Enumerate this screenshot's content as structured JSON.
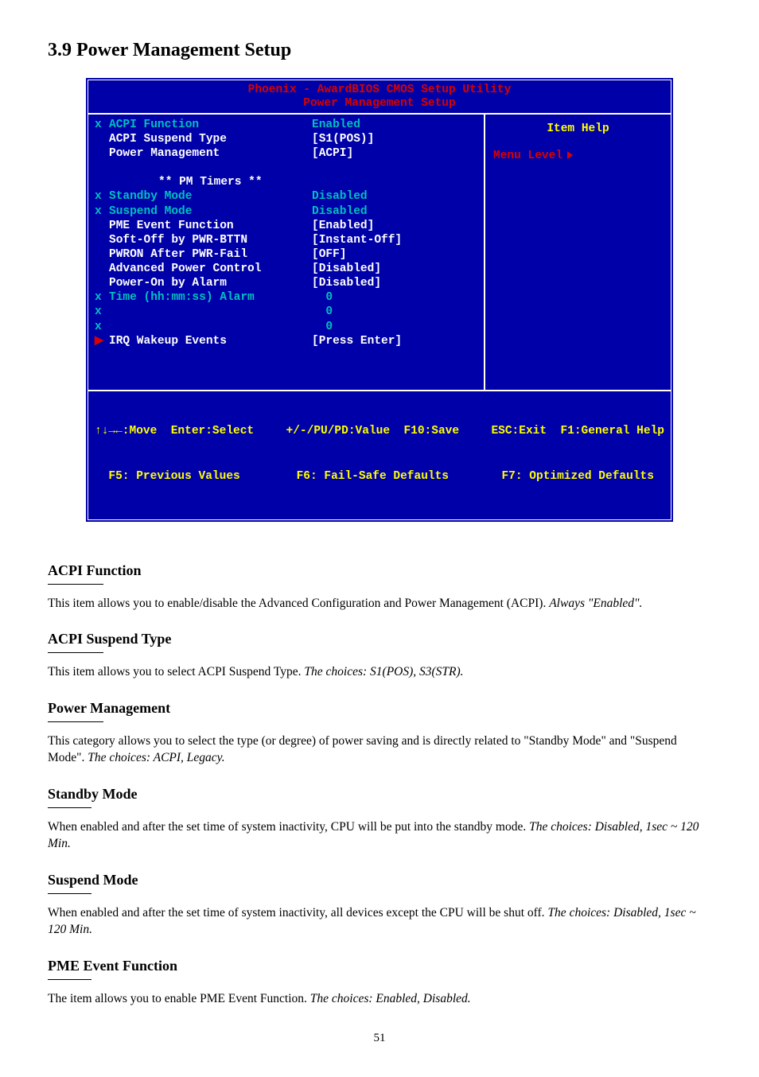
{
  "page_heading": "3.9 Power Management Setup",
  "bios": {
    "title_line1": "Phoenix - AwardBIOS CMOS Setup Utility",
    "title_line2": "Power Management Setup",
    "help_title": "Item Help",
    "menu_level": "Menu Level",
    "timers_header": "** PM Timers **",
    "rows": [
      {
        "marker": "x",
        "marker_color": "cyan",
        "label": "ACPI Function",
        "label_color": "cyan",
        "value": "Enabled",
        "value_color": "cyan"
      },
      {
        "marker": "",
        "marker_color": "",
        "label": "ACPI Suspend Type",
        "label_color": "white",
        "value": "[S1(POS)]",
        "value_color": "white"
      },
      {
        "marker": "",
        "marker_color": "",
        "label": "Power Management",
        "label_color": "white",
        "value": "[ACPI]",
        "value_color": "white"
      }
    ],
    "rows2": [
      {
        "marker": "x",
        "marker_color": "cyan",
        "label": "Standby Mode",
        "label_color": "cyan",
        "value": "Disabled",
        "value_color": "cyan"
      },
      {
        "marker": "x",
        "marker_color": "cyan",
        "label": "Suspend Mode",
        "label_color": "cyan",
        "value": "Disabled",
        "value_color": "cyan"
      },
      {
        "marker": "",
        "marker_color": "",
        "label": "PME Event Function",
        "label_color": "white",
        "value": "[Enabled]",
        "value_color": "white"
      },
      {
        "marker": "",
        "marker_color": "",
        "label": "Soft-Off by PWR-BTTN",
        "label_color": "white",
        "value": "[Instant-Off]",
        "value_color": "white"
      },
      {
        "marker": "",
        "marker_color": "",
        "label": "PWRON After PWR-Fail",
        "label_color": "white",
        "value": "[OFF]",
        "value_color": "white"
      },
      {
        "marker": "",
        "marker_color": "",
        "label": "Advanced Power Control",
        "label_color": "white",
        "value": "[Disabled]",
        "value_color": "white"
      },
      {
        "marker": "",
        "marker_color": "",
        "label": "Power-On by Alarm",
        "label_color": "white",
        "value": "[Disabled]",
        "value_color": "white"
      },
      {
        "marker": "x",
        "marker_color": "cyan",
        "label": "Time (hh:mm:ss) Alarm",
        "label_color": "cyan",
        "value": "  0",
        "value_color": "cyan"
      },
      {
        "marker": "x",
        "marker_color": "cyan",
        "label": "",
        "label_color": "cyan",
        "value": "  0",
        "value_color": "cyan"
      },
      {
        "marker": "x",
        "marker_color": "cyan",
        "label": "",
        "label_color": "cyan",
        "value": "  0",
        "value_color": "cyan"
      },
      {
        "marker": "▶",
        "marker_color": "red",
        "label": "IRQ Wakeup Events",
        "label_color": "white",
        "value": "[Press Enter]",
        "value_color": "white"
      }
    ],
    "footer": {
      "l1c1": "↑↓→←:Move  Enter:Select",
      "l1c2": "+/-/PU/PD:Value  F10:Save",
      "l1c3": "ESC:Exit  F1:General Help",
      "l2c1": "F5: Previous Values",
      "l2c2": "F6: Fail-Safe Defaults",
      "l2c3": "F7: Optimized Defaults"
    }
  },
  "sections": [
    {
      "title": "ACPI Function",
      "rule_w": "w70",
      "body_html": "This item allows you to enable/disable the Advanced Configuration and Power Management (ACPI). <span class=\"italic\">Always \"Enabled\".</span>"
    },
    {
      "title": "ACPI Suspend Type",
      "rule_w": "w70",
      "body_html": "This item allows you to select ACPI Suspend Type. <span class=\"italic\">The choices: S1(POS), S3(STR).</span>"
    },
    {
      "title": "Power Management",
      "rule_w": "w70",
      "body_html": "This category allows you to select the type (or degree) of power saving and is directly related to \"Standby Mode\" and \"Suspend Mode\". <span class=\"italic\">The choices: ACPI, Legacy.</span>"
    },
    {
      "title": "Standby Mode",
      "rule_w": "w60",
      "body_html": "When enabled and after the set time of system inactivity, CPU will be put into the standby mode. <span class=\"italic\">The choices: Disabled, 1sec ~ 120 Min.</span>"
    },
    {
      "title": "Suspend Mode",
      "rule_w": "w60",
      "body_html": "When enabled and after the set time of system inactivity, all devices except the CPU will be shut off. <span class=\"italic\">The choices: Disabled, 1sec ~ 120 Min.</span>"
    },
    {
      "title": "PME Event Function",
      "rule_w": "w60",
      "body_html": "The item allows you to enable PME Event Function. <span class=\"italic\">The choices: Enabled, Disabled.</span>"
    }
  ],
  "page_number": "51"
}
